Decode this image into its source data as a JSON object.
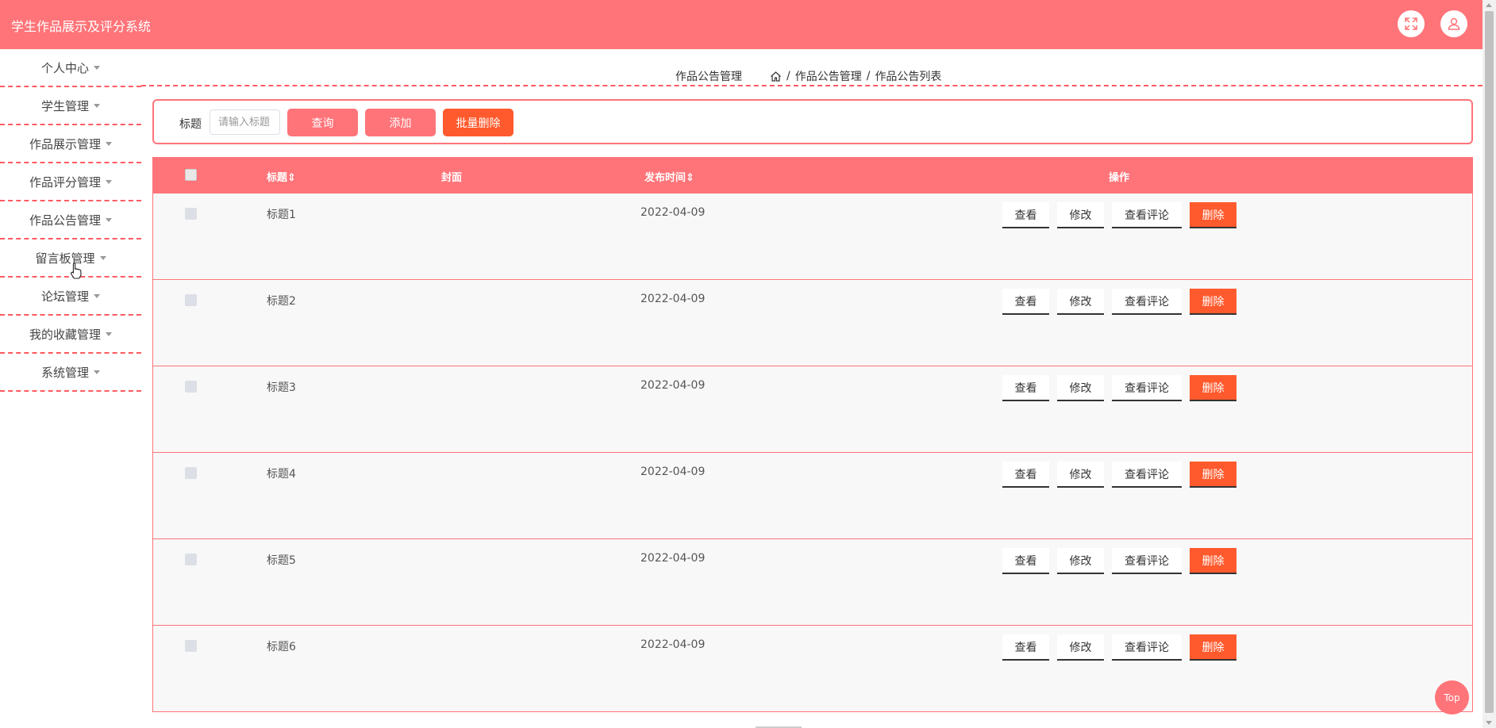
{
  "app": {
    "title": "学生作品展示及评分系统"
  },
  "topbar": {
    "fullscreen_icon": "expand-icon",
    "user_icon": "user-icon"
  },
  "sidebar": {
    "items": [
      {
        "label": "个人中心"
      },
      {
        "label": "学生管理"
      },
      {
        "label": "作品展示管理"
      },
      {
        "label": "作品评分管理"
      },
      {
        "label": "作品公告管理"
      },
      {
        "label": "留言板管理"
      },
      {
        "label": "论坛管理"
      },
      {
        "label": "我的收藏管理"
      },
      {
        "label": "系统管理"
      }
    ]
  },
  "breadcrumb": {
    "page_title": "作品公告管理",
    "home_icon": "home-icon",
    "level1": "作品公告管理",
    "level2": "作品公告列表",
    "sep": "/"
  },
  "search": {
    "label": "标题",
    "placeholder": "请输入标题",
    "query_button": "查询",
    "add_button": "添加",
    "batch_delete_button": "批量删除"
  },
  "table": {
    "headers": {
      "title": "标题",
      "cover": "封面",
      "publish_time": "发布时间",
      "actions": "操作"
    },
    "rows": [
      {
        "title": "标题1",
        "date": "2022-04-09"
      },
      {
        "title": "标题2",
        "date": "2022-04-09"
      },
      {
        "title": "标题3",
        "date": "2022-04-09"
      },
      {
        "title": "标题4",
        "date": "2022-04-09"
      },
      {
        "title": "标题5",
        "date": "2022-04-09"
      },
      {
        "title": "标题6",
        "date": "2022-04-09"
      }
    ],
    "actions": {
      "view": "查看",
      "edit": "修改",
      "view_comments": "查看评论",
      "delete": "删除"
    }
  },
  "floating": {
    "top_button": "Top"
  },
  "colors": {
    "primary": "#ff7479",
    "danger": "#ff5a2d"
  }
}
